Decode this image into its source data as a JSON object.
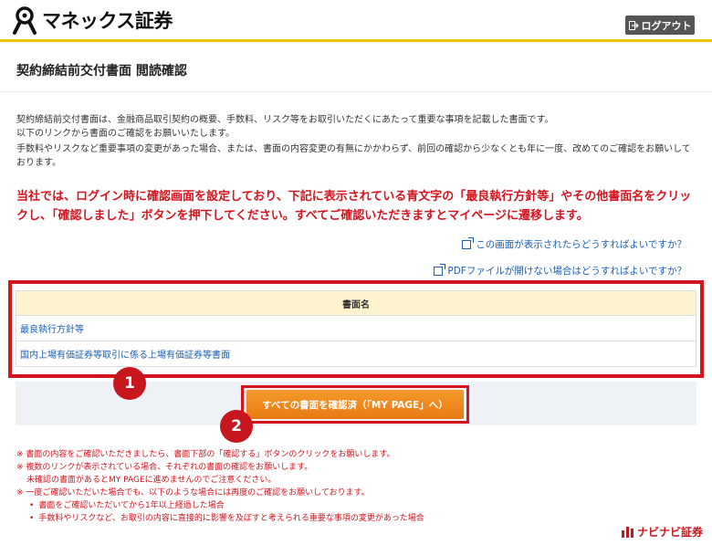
{
  "header": {
    "brand": "マネックス証券",
    "logout_label": "ログアウト"
  },
  "page": {
    "title": "契約締結前交付書面 閲読確認",
    "intro_line1": "契約締結前交付書面は、金融商品取引契約の概要、手数料、リスク等をお取引いただくにあたって重要な事項を記載した書面です。",
    "intro_line2": "以下のリンクから書面のご確認をお願いいたします。",
    "intro_para2": "手数料やリスクなど重要事項の変更があった場合、または、書面の内容変更の有無にかかわらず、前回の確認から少なくとも年に一度、改めてのご確認をお願いしております。",
    "notice": "当社では、ログイン時に確認画面を設定しており、下記に表示されている青文字の「最良執行方針等」やその他書面名をクリックし、「確認しました」ボタンを押下してください。すべてご確認いただきますとマイページに遷移します。"
  },
  "help_links": [
    "この画面が表示されたらどうすればよいですか？",
    "PDFファイルが開けない場合はどうすればよいですか？"
  ],
  "documents": {
    "header": "書面名",
    "rows": [
      "最良執行方針等",
      "国内上場有価証券等取引に係る上場有価証券等書面"
    ]
  },
  "badges": [
    "1",
    "2"
  ],
  "confirm_button": "すべての書面を確認済（「MY PAGE」へ）",
  "notes": {
    "n1": "※ 書面の内容をご確認いただきましたら、書面下部の「確認する」ボタンのクリックをお願いします。",
    "n2": "※ 複数のリンクが表示されている場合、それぞれの書面の確認をお願いします。",
    "n2b": "未確認の書面があるとMY PAGEに進めませんのでご注意ください。",
    "n3": "※ 一度ご確認いただいた場合でも、以下のような場合には再度のご確認をお願いしております。",
    "bullets": [
      "書面をご確認いただいてから1年以上経過した場合",
      "手数料やリスクなど、お取引の内容に直接的に影響を及ぼすと考えられる重要な事項の変更があった場合"
    ]
  },
  "footer_brand": "ナビナビ証券",
  "colors": {
    "accent_yellow": "#f2c200",
    "alert_red": "#d4141e",
    "link_blue": "#1a5fb4",
    "button_orange": "#ef8a1e"
  }
}
